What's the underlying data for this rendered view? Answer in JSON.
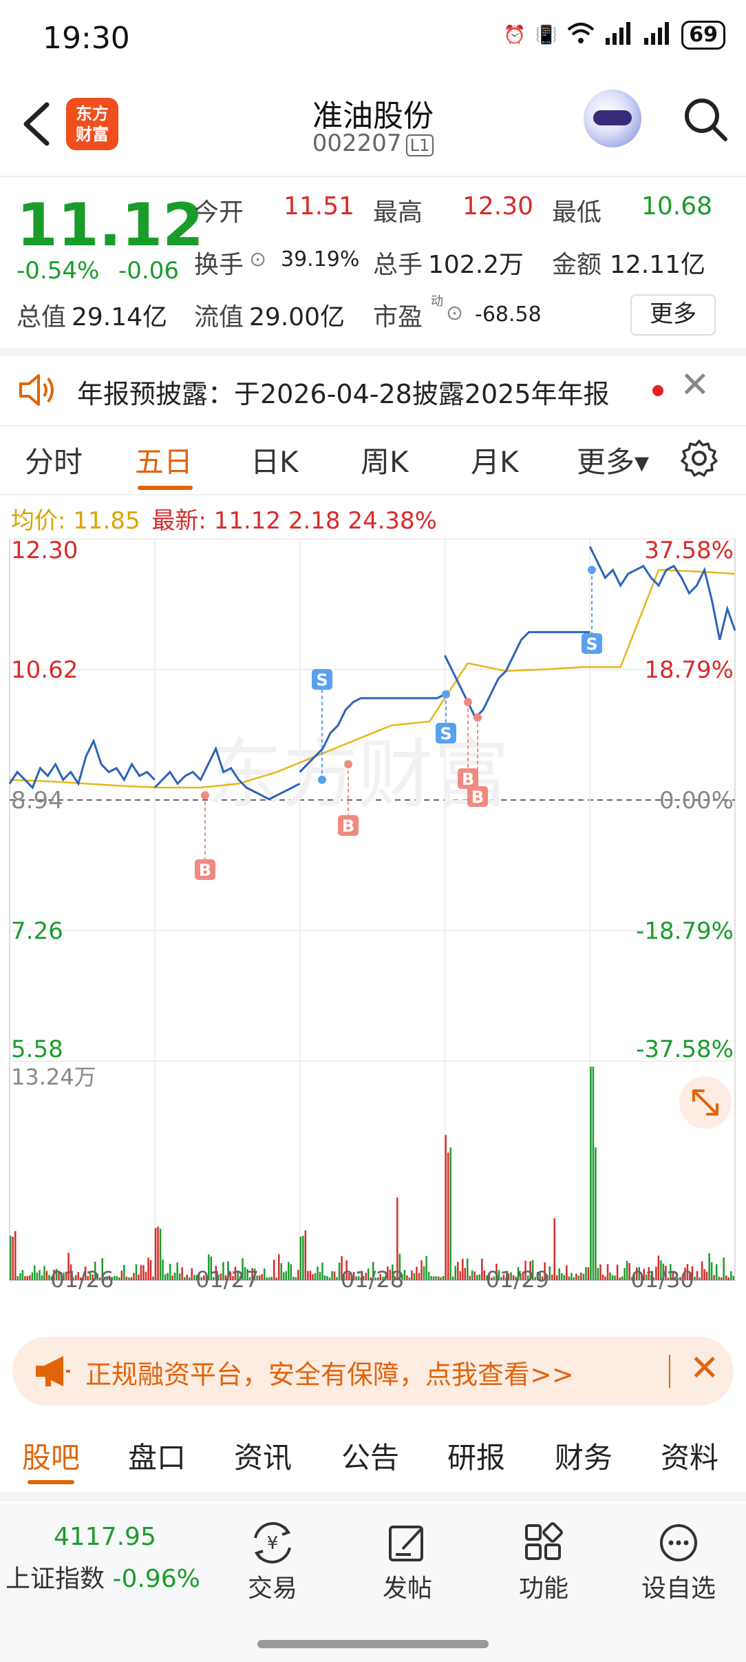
{
  "status_bar": {
    "time": "19:30",
    "battery": "69"
  },
  "header": {
    "back_icon": "chevron-left-icon",
    "logo_line1": "东方",
    "logo_line2": "财富",
    "title": "准油股份",
    "code": "002207",
    "level_badge": "L1"
  },
  "quote": {
    "price": "11.12",
    "change_pct": "-0.54%",
    "change_abs": "-0.06",
    "open_label": "今开",
    "open": "11.51",
    "high_label": "最高",
    "high": "12.30",
    "low_label": "最低",
    "low": "10.68",
    "turnover_label": "换手",
    "turnover": "39.19%",
    "volume_label": "总手",
    "volume": "102.2万",
    "amount_label": "金额",
    "amount": "12.11亿",
    "mcap_label": "总值",
    "mcap": "29.14亿",
    "float_label": "流值",
    "float_cap": "29.00亿",
    "pe_label": "市盈",
    "pe_sup": "动",
    "pe": "-68.58",
    "more_button": "更多"
  },
  "notice": {
    "text": "年报预披露：于2026-04-28披露2025年年报"
  },
  "tabs": [
    "分时",
    "五日",
    "日K",
    "周K",
    "月K",
    "更多▾"
  ],
  "active_tab": "五日",
  "chart_legend": {
    "avg_label": "均价: 11.85",
    "latest_label": "最新: 11.12 2.18 24.38%"
  },
  "chart_data": {
    "type": "line",
    "title": "",
    "y_left_ticks": [
      "12.30",
      "10.62",
      "8.94",
      "7.26",
      "5.58"
    ],
    "y_right_ticks": [
      "37.58%",
      "18.79%",
      "0.00%",
      "-18.79%",
      "-37.58%"
    ],
    "ylim": [
      5.58,
      12.3
    ],
    "prev_close": 8.94,
    "x_labels": [
      "01/26",
      "01/27",
      "01/28",
      "01/29",
      "01/30"
    ],
    "volume_max_label": "13.24万",
    "series": [
      {
        "values": [
          9.1,
          9.2,
          9.3,
          9.15,
          9.25,
          9.3,
          9.2,
          9.4,
          9.6,
          9.3,
          9.35,
          9.2,
          9.1,
          9.05,
          9.0,
          8.95,
          9.0,
          9.05,
          9.1,
          9.15
        ]
      },
      {
        "values": [
          9.3,
          9.4,
          9.5,
          9.6,
          9.8,
          9.9,
          10.1,
          10.2,
          10.25,
          10.25,
          10.25,
          10.25,
          10.25,
          10.25,
          10.25,
          10.25,
          10.25,
          10.25,
          10.25,
          10.3
        ]
      },
      {
        "values": [
          10.8,
          10.6,
          10.4,
          10.2,
          10.0,
          10.1,
          10.3,
          10.5,
          10.6,
          10.8,
          11.0,
          11.1,
          11.1,
          11.1,
          11.1,
          11.1,
          11.1,
          11.1,
          11.1,
          11.1
        ]
      },
      {
        "values": [
          12.2,
          12.0,
          11.8,
          11.9,
          11.7,
          11.85,
          11.9,
          11.95,
          11.8,
          11.7,
          11.9,
          11.95,
          11.8,
          11.6,
          11.7,
          11.9,
          11.5,
          11.0,
          11.4,
          11.12
        ]
      }
    ],
    "avg_series": [
      9.2,
      9.18,
      9.15,
      9.12,
      9.1,
      9.1,
      9.15,
      9.3,
      9.5,
      9.7,
      9.9,
      9.95,
      10.7,
      10.6,
      10.62,
      10.65,
      10.65,
      11.9,
      11.88,
      11.85
    ],
    "buy_marker": "B",
    "sell_marker": "S"
  },
  "promo": {
    "text": "正规融资平台，安全有保障，点我查看>>"
  },
  "sub_tabs": [
    "股吧",
    "盘口",
    "资讯",
    "公告",
    "研报",
    "财务",
    "资料"
  ],
  "active_sub_tab": "股吧",
  "bottom_bar": {
    "index_value": "4117.95",
    "index_name": "上证指数",
    "index_change": "-0.96%",
    "items": [
      {
        "label": "交易",
        "icon": "yen-exchange-icon"
      },
      {
        "label": "发帖",
        "icon": "edit-post-icon"
      },
      {
        "label": "功能",
        "icon": "grid-apps-icon"
      },
      {
        "label": "设自选",
        "icon": "more-dots-icon"
      }
    ]
  }
}
